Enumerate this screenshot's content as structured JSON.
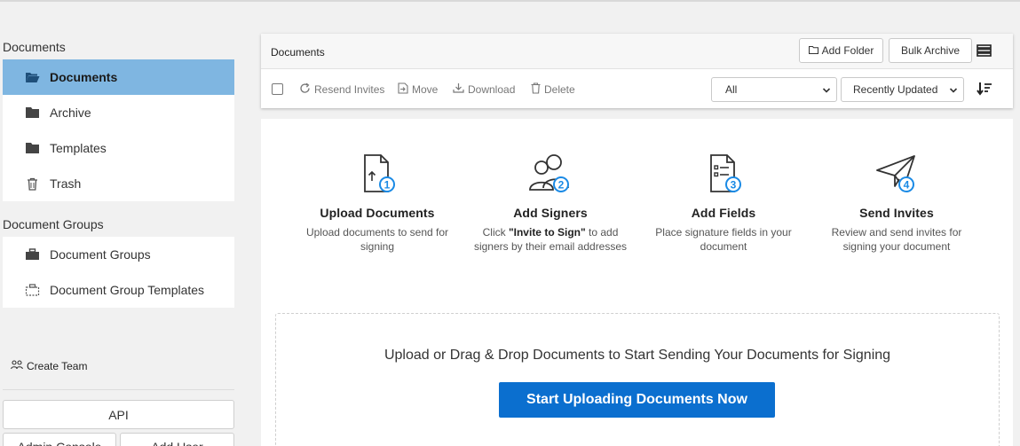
{
  "sidebar": {
    "documents_title": "Documents",
    "document_items": [
      {
        "label": "Documents",
        "icon": "folder-open-icon"
      },
      {
        "label": "Archive",
        "icon": "folder-icon"
      },
      {
        "label": "Templates",
        "icon": "folder-icon"
      },
      {
        "label": "Trash",
        "icon": "trash-icon"
      }
    ],
    "groups_title": "Document Groups",
    "group_items": [
      {
        "label": "Document Groups",
        "icon": "briefcase-icon"
      },
      {
        "label": "Document Group Templates",
        "icon": "briefcase-outline-icon"
      }
    ],
    "create_team": "Create Team",
    "api_button": "API",
    "admin_console_button": "Admin Console",
    "add_user_button": "Add User"
  },
  "toolbar": {
    "title": "Documents",
    "add_folder": "Add Folder",
    "bulk_archive": "Bulk Archive",
    "actions": {
      "resend": "Resend Invites",
      "move": "Move",
      "download": "Download",
      "delete": "Delete"
    },
    "filter_selected": "All",
    "sort_selected": "Recently Updated"
  },
  "steps": [
    {
      "title": "Upload Documents",
      "desc": "Upload documents to send for signing",
      "number": "1"
    },
    {
      "title": "Add Signers",
      "desc_pre": "Click ",
      "desc_bold": "\"Invite to Sign\"",
      "desc_post": " to add signers by their email addresses",
      "number": "2"
    },
    {
      "title": "Add Fields",
      "desc": "Place signature fields in your document",
      "number": "3"
    },
    {
      "title": "Send Invites",
      "desc": "Review and send invites for signing your document",
      "number": "4"
    }
  ],
  "dropzone": {
    "text": "Upload or Drag & Drop Documents to Start Sending Your Documents for Signing",
    "button": "Start Uploading Documents Now"
  },
  "colors": {
    "accent": "#0b6fcf",
    "active_nav": "#7fb6e1",
    "badge": "#1a8ae5"
  }
}
